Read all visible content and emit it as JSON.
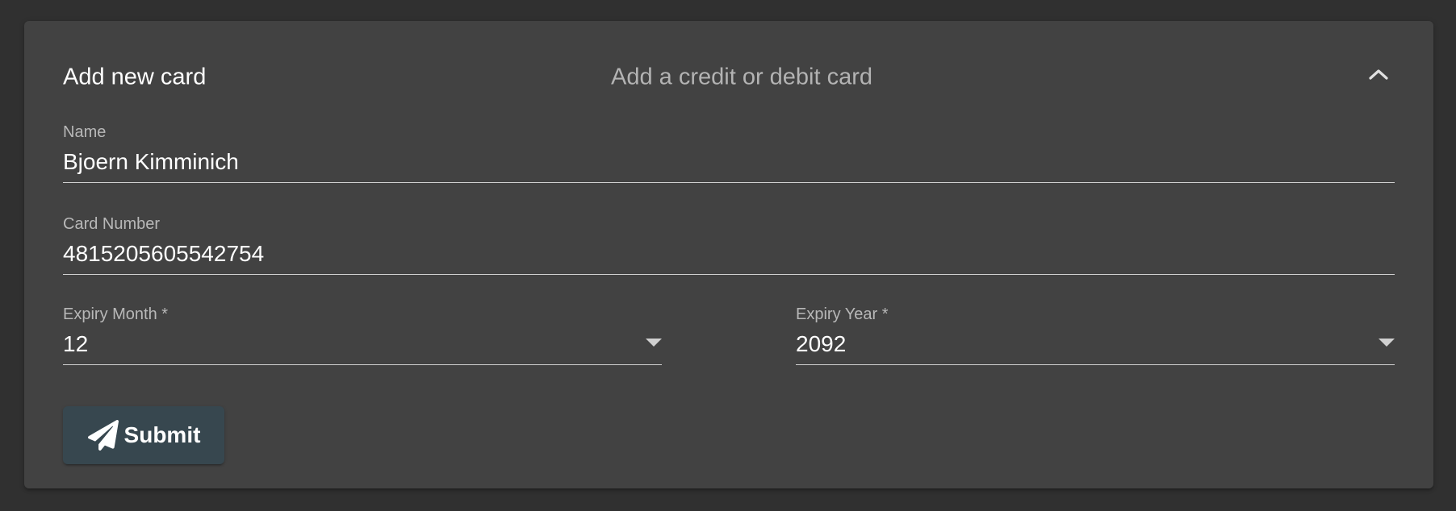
{
  "panel": {
    "title": "Add new card",
    "description": "Add a credit or debit card",
    "toggle_icon": "chevron-up-icon"
  },
  "form": {
    "name": {
      "label": "Name",
      "value": "Bjoern Kimminich"
    },
    "card_number": {
      "label": "Card Number",
      "value": "4815205605542754"
    },
    "expiry_month": {
      "label": "Expiry Month *",
      "value": "12"
    },
    "expiry_year": {
      "label": "Expiry Year *",
      "value": "2092"
    },
    "submit": {
      "label": "Submit",
      "icon": "paper-plane-icon"
    }
  },
  "colors": {
    "background": "#303030",
    "panel": "#424242",
    "button": "#37474f",
    "text": "#ffffff",
    "muted_text": "#b3b3b3"
  }
}
